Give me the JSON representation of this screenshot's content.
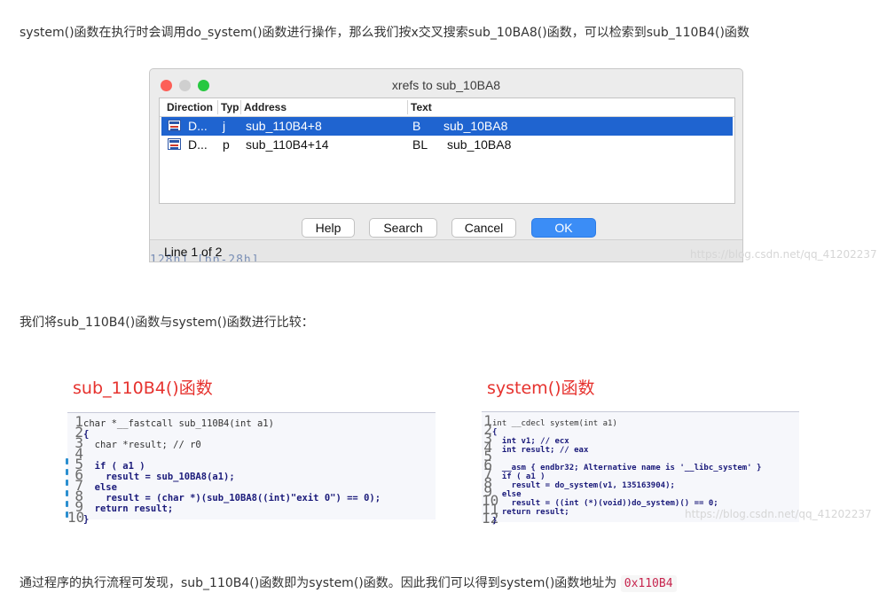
{
  "intro_text": "system()函数在执行时会调用do_system()函数进行操作，那么我们按x交叉搜索sub_10BA8()函数，可以检索到sub_110B4()函数",
  "dialog": {
    "title": "xrefs to sub_10BA8",
    "columns": [
      "Direction",
      "Typ",
      "Address",
      "Text"
    ],
    "rows": [
      {
        "direction": "D...",
        "type": "j",
        "address": "sub_110B4+8",
        "text_op": "B",
        "text_arg": "sub_10BA8",
        "selected": true
      },
      {
        "direction": "D...",
        "type": "p",
        "address": "sub_110B4+14",
        "text_op": "BL",
        "text_arg": "sub_10BA8",
        "selected": false
      }
    ],
    "buttons": {
      "help": "Help",
      "search": "Search",
      "cancel": "Cancel",
      "ok": "OK"
    },
    "status": "Line 1 of 2",
    "underlap_text": "128h] [bp-28h]"
  },
  "watermark": "https://blog.csdn.net/qq_41202237",
  "compare_text": "我们将sub_110B4()函数与system()函数进行比较：",
  "left_code": {
    "title": "sub_110B4()函数",
    "lines": [
      {
        "n": "1",
        "text": "char *__fastcall sub_110B4(int a1)"
      },
      {
        "n": "2",
        "text": "{"
      },
      {
        "n": "3",
        "text": "  char *result; // r0"
      },
      {
        "n": "4",
        "text": ""
      },
      {
        "n": "5",
        "text": "  if ( a1 )"
      },
      {
        "n": "6",
        "text": "    result = sub_10BA8(a1);"
      },
      {
        "n": "7",
        "text": "  else"
      },
      {
        "n": "8",
        "text": "    result = (char *)(sub_10BA8((int)\"exit 0\") == 0);"
      },
      {
        "n": "9",
        "text": "  return result;"
      },
      {
        "n": "10",
        "text": "}"
      }
    ]
  },
  "right_code": {
    "title": "system()函数",
    "lines": [
      {
        "n": "1",
        "text": "int __cdecl system(int a1)"
      },
      {
        "n": "2",
        "text": "{"
      },
      {
        "n": "3",
        "text": "  int v1; // ecx"
      },
      {
        "n": "4",
        "text": "  int result; // eax"
      },
      {
        "n": "5",
        "text": ""
      },
      {
        "n": "6",
        "text": "  __asm { endbr32; Alternative name is '__libc_system' }"
      },
      {
        "n": "7",
        "text": "  if ( a1 )"
      },
      {
        "n": "8",
        "text": "    result = do_system(v1, 135163904);"
      },
      {
        "n": "9",
        "text": "  else"
      },
      {
        "n": "10",
        "text": "    result = ((int (*)(void))do_system)() == 0;"
      },
      {
        "n": "11",
        "text": "  return result;"
      },
      {
        "n": "12",
        "text": "}"
      }
    ]
  },
  "conclusion_text": "通过程序的执行流程可发现，sub_110B4()函数即为system()函数。因此我们可以得到system()函数地址为",
  "conclusion_code": "0x110B4"
}
